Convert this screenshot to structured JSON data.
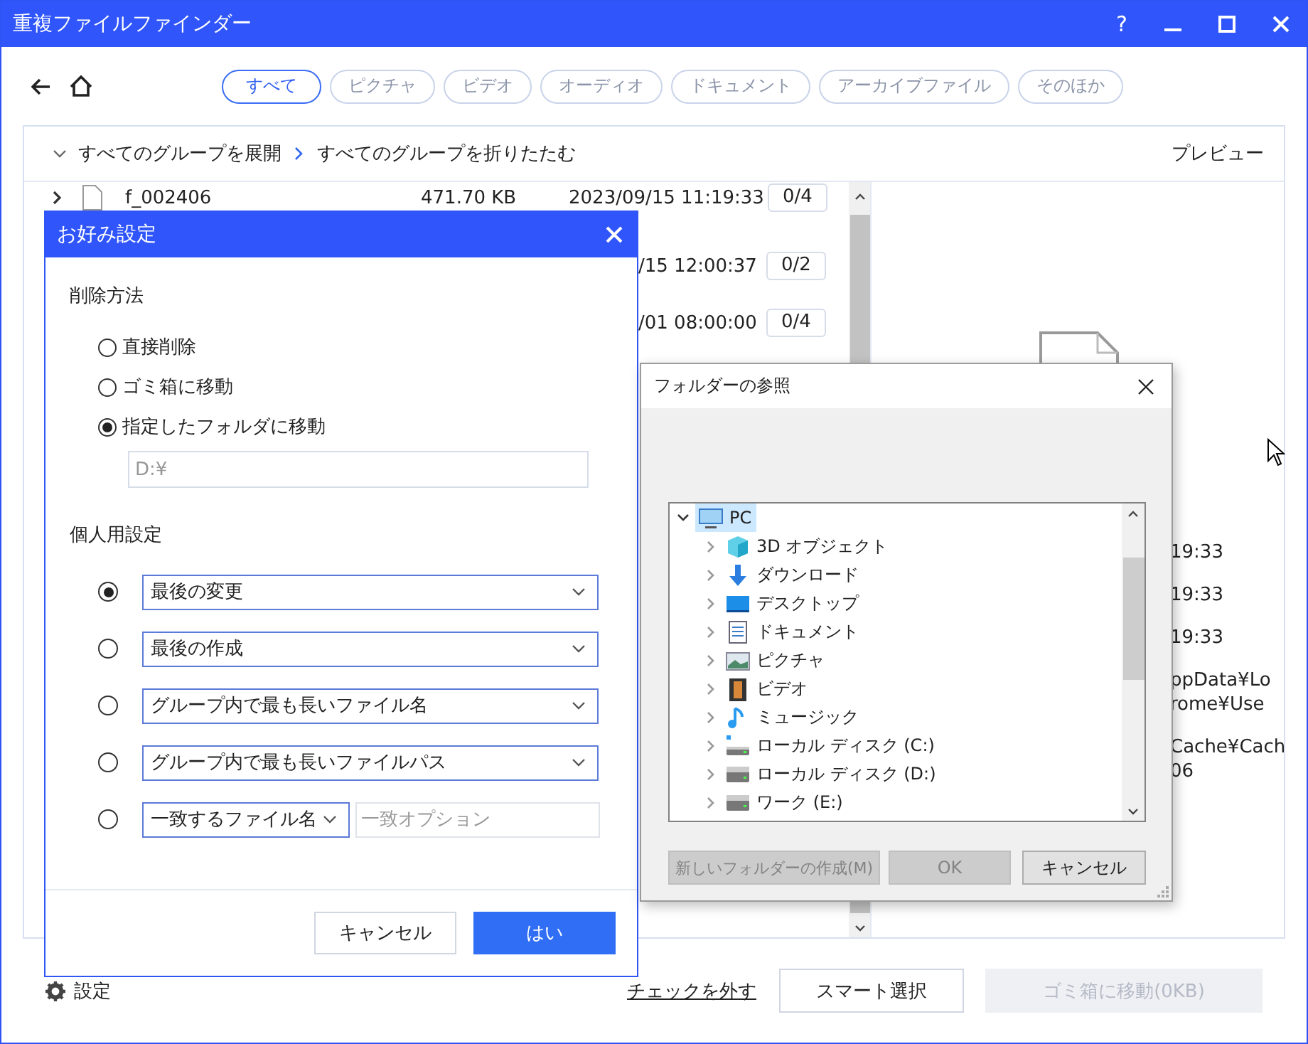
{
  "window": {
    "title": "重複ファイルファインダー",
    "help": "?"
  },
  "toolbar": {
    "tabs": [
      {
        "label": "すべて",
        "selected": true
      },
      {
        "label": "ピクチャ",
        "selected": false
      },
      {
        "label": "ビデオ",
        "selected": false
      },
      {
        "label": "オーディオ",
        "selected": false
      },
      {
        "label": "ドキュメント",
        "selected": false
      },
      {
        "label": "アーカイブファイル",
        "selected": false
      },
      {
        "label": "そのほか",
        "selected": false
      }
    ]
  },
  "group_bar": {
    "expand": "すべてのグループを展開",
    "collapse": "すべてのグループを折りたたむ",
    "preview": "プレビュー"
  },
  "file_rows": [
    {
      "name": "f_002406",
      "size": "471.70 KB",
      "date": "2023/09/15 11:19:33",
      "count": "0/4"
    },
    {
      "date": "/15 12:00:37",
      "count": "0/2"
    },
    {
      "date": "/01 08:00:00",
      "count": "0/4"
    }
  ],
  "preview": {
    "details": [
      [
        "19:33"
      ],
      [
        "19:33"
      ],
      [
        "19:33"
      ],
      [
        "ppData¥Lo",
        "rome¥Use"
      ],
      [
        "Cache¥Cach",
        "06"
      ]
    ]
  },
  "footer": {
    "settings": "設定",
    "uncheck": "チェックを外す",
    "smart_select": "スマート選択",
    "move_button": {
      "label": "ゴミ箱に移動(0KB)",
      "disabled": true
    }
  },
  "preferences_dialog": {
    "title": "お好み設定",
    "delete_heading": "削除方法",
    "delete_options": [
      {
        "label": "直接削除",
        "selected": false
      },
      {
        "label": "ゴミ箱に移動",
        "selected": false
      },
      {
        "label": "指定したフォルダに移動",
        "selected": true
      }
    ],
    "folder_field": {
      "value": "D:¥",
      "disabled": true
    },
    "personal_heading": "個人用設定",
    "rules": [
      {
        "kind": "dropdown",
        "value": "最後の変更",
        "selected": true
      },
      {
        "kind": "dropdown",
        "value": "最後の作成",
        "selected": false
      },
      {
        "kind": "dropdown",
        "value": "グループ内で最も長いファイル名",
        "selected": false
      },
      {
        "kind": "dropdown",
        "value": "グループ内で最も長いファイルパス",
        "selected": false
      },
      {
        "kind": "match",
        "value": "一致するファイル名",
        "placeholder": "一致オプション",
        "selected": false
      }
    ],
    "cancel": "キャンセル",
    "ok": "はい"
  },
  "folder_dialog": {
    "title": "フォルダーの参照",
    "tree": [
      {
        "label": "PC",
        "kind": "pc",
        "expanded": true,
        "selected": true,
        "children": [
          {
            "label": "3D オブジェクト",
            "kind": "cube",
            "expanded": false,
            "selected": false
          },
          {
            "label": "ダウンロード",
            "kind": "download",
            "expanded": false,
            "selected": false
          },
          {
            "label": "デスクトップ",
            "kind": "desktop",
            "expanded": false,
            "selected": false
          },
          {
            "label": "ドキュメント",
            "kind": "document",
            "expanded": false,
            "selected": false
          },
          {
            "label": "ピクチャ",
            "kind": "pictures",
            "expanded": false,
            "selected": false
          },
          {
            "label": "ビデオ",
            "kind": "video",
            "expanded": false,
            "selected": false
          },
          {
            "label": "ミュージック",
            "kind": "music",
            "expanded": false,
            "selected": false
          },
          {
            "label": "ローカル ディスク (C:)",
            "kind": "system_drive",
            "expanded": false,
            "selected": false
          },
          {
            "label": "ローカル ディスク (D:)",
            "kind": "drive",
            "expanded": false,
            "selected": false
          },
          {
            "label": "ワーク (E:)",
            "kind": "drive",
            "expanded": false,
            "selected": false
          }
        ]
      }
    ],
    "buttons": [
      {
        "label": "新しいフォルダーの作成(M)",
        "disabled": true
      },
      {
        "label": "OK",
        "disabled": true
      },
      {
        "label": "キャンセル",
        "disabled": false
      }
    ]
  }
}
